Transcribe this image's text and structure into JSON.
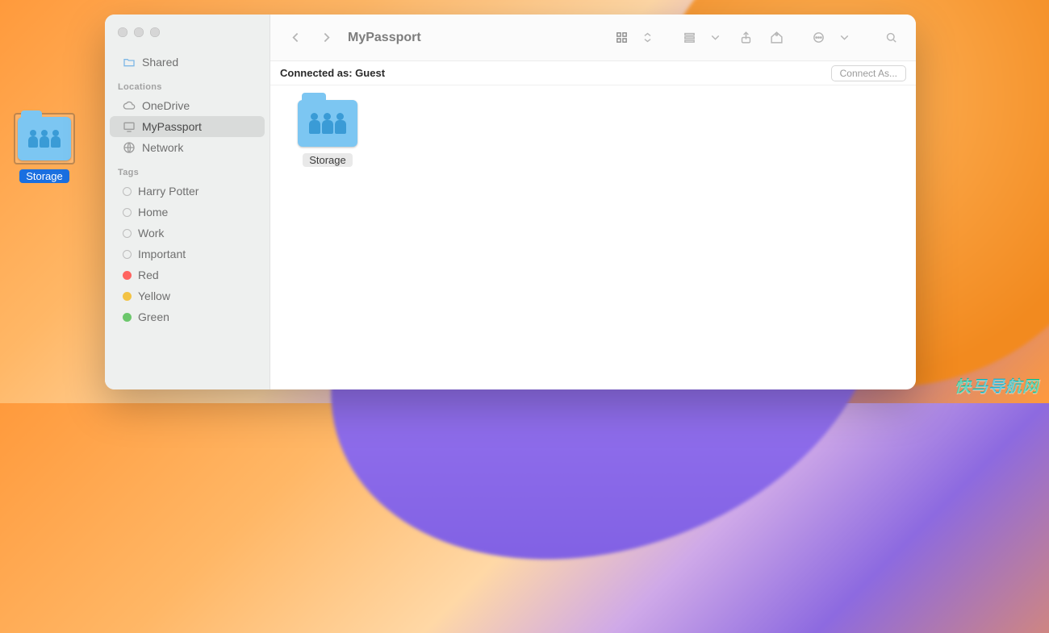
{
  "desktop": {
    "icon_name": "Storage"
  },
  "finder": {
    "title": "MyPassport",
    "sidebar": {
      "shared_label": "Shared",
      "locations_header": "Locations",
      "locations": [
        {
          "label": "OneDrive"
        },
        {
          "label": "MyPassport"
        },
        {
          "label": "Network"
        }
      ],
      "tags_header": "Tags",
      "tags": [
        {
          "label": "Harry Potter",
          "color": "none"
        },
        {
          "label": "Home",
          "color": "none"
        },
        {
          "label": "Work",
          "color": "none"
        },
        {
          "label": "Important",
          "color": "none"
        },
        {
          "label": "Red",
          "color": "red"
        },
        {
          "label": "Yellow",
          "color": "yellow"
        },
        {
          "label": "Green",
          "color": "green"
        }
      ]
    },
    "infobar": {
      "status_text": "Connected as: Guest",
      "connect_button": "Connect As..."
    },
    "items": [
      {
        "name": "Storage"
      }
    ]
  },
  "watermark": "快马导航网"
}
